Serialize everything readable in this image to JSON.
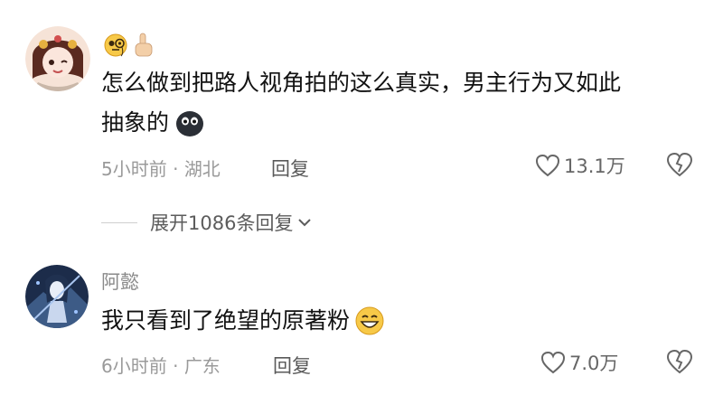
{
  "comments": [
    {
      "user": "",
      "line1": "怎么做到把路人视角拍的这么真实，男主行为又如此",
      "line2": "抽象的",
      "emojis": [
        "monocle-face",
        "pointing-up-hand",
        "dark-blob-face"
      ],
      "time": "5小时前",
      "location": "湖北",
      "reply_label": "回复",
      "likes": "13.1万"
    },
    {
      "user": "阿懿",
      "text": "我只看到了绝望的原著粉",
      "emojis": [
        "grinning-face"
      ],
      "time": "6小时前",
      "location": "广东",
      "reply_label": "回复",
      "likes": "7.0万"
    }
  ],
  "expand_replies": "展开1086条回复",
  "separator": "·"
}
